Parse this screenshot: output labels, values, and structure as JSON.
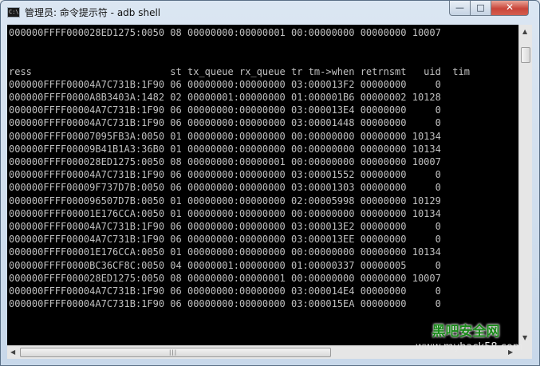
{
  "window": {
    "title": "管理员: 命令提示符 - adb  shell",
    "icon_text": "C:\\",
    "buttons": {
      "minimize": "—",
      "maximize": "□",
      "close": "✕"
    }
  },
  "console": {
    "lines": [
      "000000FFFF000028ED1275:0050 08 00000000:00000001 00:00000000 00000000 10007",
      "",
      "",
      "ress                        st tx_queue rx_queue tr tm->when retrnsmt   uid  tim",
      "000000FFFF00004A7C731B:1F90 06 00000000:00000000 03:000013F2 00000000     0",
      "000000FFFF0000A8B3403A:1482 02 00000001:00000000 01:000001B6 00000002 10128",
      "000000FFFF00004A7C731B:1F90 06 00000000:00000000 03:000013E4 00000000     0",
      "000000FFFF00004A7C731B:1F90 06 00000000:00000000 03:00001448 00000000     0",
      "000000FFFF00007095FB3A:0050 01 00000000:00000000 00:00000000 00000000 10134",
      "000000FFFF00009B41B1A3:36B0 01 00000000:00000000 00:00000000 00000000 10134",
      "000000FFFF000028ED1275:0050 08 00000000:00000001 00:00000000 00000000 10007",
      "000000FFFF00004A7C731B:1F90 06 00000000:00000000 03:00001552 00000000     0",
      "000000FFFF00009F737D7B:0050 06 00000000:00000000 03:00001303 00000000     0",
      "000000FFFF000096507D7B:0050 01 00000000:00000000 02:00005998 00000000 10129",
      "000000FFFF00001E176CCA:0050 01 00000000:00000000 00:00000000 00000000 10134",
      "000000FFFF00004A7C731B:1F90 06 00000000:00000000 03:000013E2 00000000     0",
      "000000FFFF00004A7C731B:1F90 06 00000000:00000000 03:000013EE 00000000     0",
      "000000FFFF00001E176CCA:0050 01 00000000:00000000 00:00000000 00000000 10134",
      "000000FFFF0000BC36CF8C:0050 04 00000001:00000000 01:00000337 00000005     0",
      "000000FFFF000028ED1275:0050 08 00000000:00000001 00:00000000 00000000 10007",
      "000000FFFF00004A7C731B:1F90 06 00000000:00000000 03:000014E4 00000000     0",
      "000000FFFF00004A7C731B:1F90 06 00000000:00000000 03:000015EA 00000000     0"
    ]
  },
  "scrollbars": {
    "up_arrow": "▲",
    "down_arrow": "▼",
    "left_arrow": "◀",
    "right_arrow": "▶",
    "grip": "|||"
  },
  "watermark": {
    "name": "黑吧安全网",
    "url": "www.myhack58.com"
  },
  "colors": {
    "console_bg": "#000000",
    "console_text": "#c0c0c0",
    "close_button": "#c9453a",
    "watermark_green": "#1a8a1a"
  }
}
